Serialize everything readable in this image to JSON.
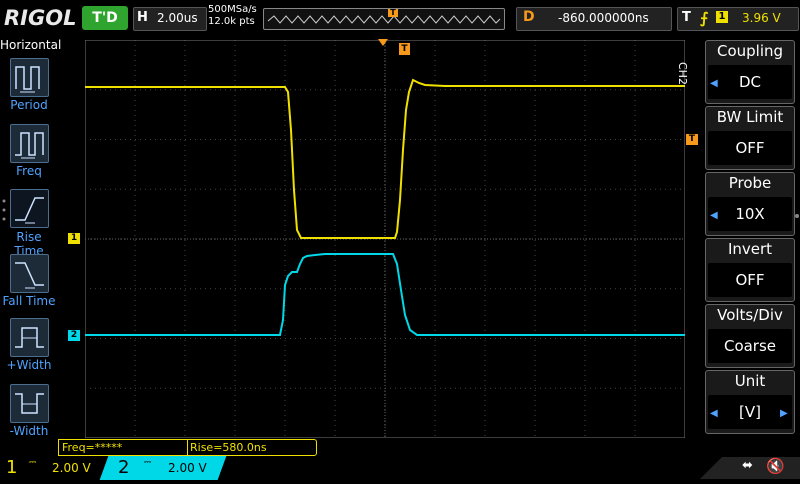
{
  "topbar": {
    "brand": "RIGOL",
    "run_status": "T'D",
    "horizontal_label": "H",
    "timebase": "2.00us",
    "sample_rate": "500MSa/s",
    "memory_depth": "12.0k pts",
    "delay_label": "D",
    "delay_value": "-860.000000ns",
    "trigger_label": "T",
    "trigger_source": "1",
    "trigger_level": "3.96 V"
  },
  "left_menu": {
    "title": "Horizontal",
    "items": [
      {
        "label": "Period",
        "icon": "period-icon"
      },
      {
        "label": "Freq",
        "icon": "freq-icon"
      },
      {
        "label": "Rise Time",
        "icon": "rise-time-icon"
      },
      {
        "label": "Fall Time",
        "icon": "fall-time-icon"
      },
      {
        "label": "+Width",
        "icon": "pos-width-icon"
      },
      {
        "label": "-Width",
        "icon": "neg-width-icon"
      }
    ]
  },
  "right_menu": {
    "channel_tag": "CH2",
    "items": [
      {
        "title": "Coupling",
        "value": "DC"
      },
      {
        "title": "BW Limit",
        "value": "OFF"
      },
      {
        "title": "Probe",
        "value": "10X"
      },
      {
        "title": "Invert",
        "value": "OFF"
      },
      {
        "title": "Volts/Div",
        "value": "Coarse"
      },
      {
        "title": "Unit",
        "value": "[V]"
      }
    ]
  },
  "measurements": {
    "freq": "Freq=*****",
    "rise": "Rise=580.0ns"
  },
  "channels": [
    {
      "number": "1",
      "scale": "2.00 V",
      "color": "#f0e000"
    },
    {
      "number": "2",
      "scale": "2.00 V",
      "color": "#00d8e8"
    }
  ],
  "markers": {
    "trigger_marker": "T",
    "ch1_marker": "1",
    "ch2_marker": "2"
  },
  "colors": {
    "ch1": "#f0e000",
    "ch2": "#00d8e8",
    "trigger": "#f79a1b",
    "grid": "#555555"
  }
}
